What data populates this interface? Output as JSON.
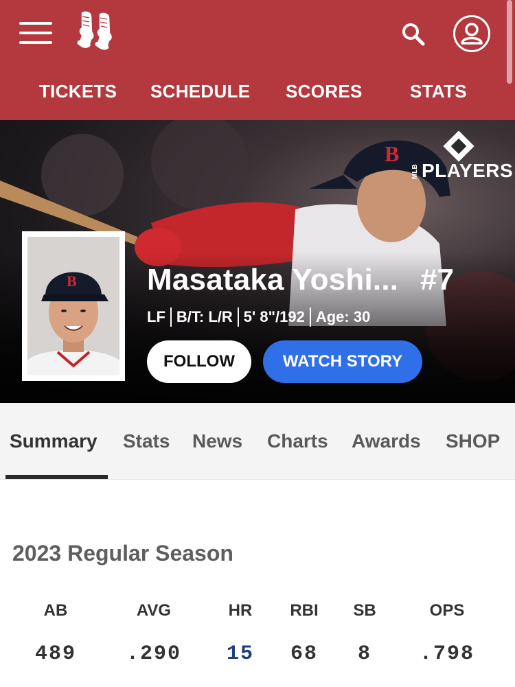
{
  "header": {
    "nav": [
      "TICKETS",
      "SCHEDULE",
      "SCORES",
      "STATS"
    ]
  },
  "hero": {
    "badge_text": "PLAYERS",
    "badge_small": "MLB",
    "player_name": "Masataka Yoshi...",
    "number": "#7",
    "meta": [
      "LF",
      "B/T: L/R",
      "5' 8\"/192",
      "Age: 30"
    ],
    "follow_label": "FOLLOW",
    "watch_label": "WATCH STORY"
  },
  "tabs": [
    "Summary",
    "Stats",
    "News",
    "Charts",
    "Awards",
    "SHOP"
  ],
  "season": {
    "title": "2023 Regular Season",
    "stats": [
      {
        "label": "AB",
        "value": "489"
      },
      {
        "label": "AVG",
        "value": ".290"
      },
      {
        "label": "HR",
        "value": "15"
      },
      {
        "label": "RBI",
        "value": "68"
      },
      {
        "label": "SB",
        "value": "8"
      },
      {
        "label": "OPS",
        "value": ".798"
      }
    ]
  },
  "colors": {
    "header_red": "#b3393f",
    "watch_blue": "#2f6fe8",
    "link_navy": "#1d3f7a"
  }
}
